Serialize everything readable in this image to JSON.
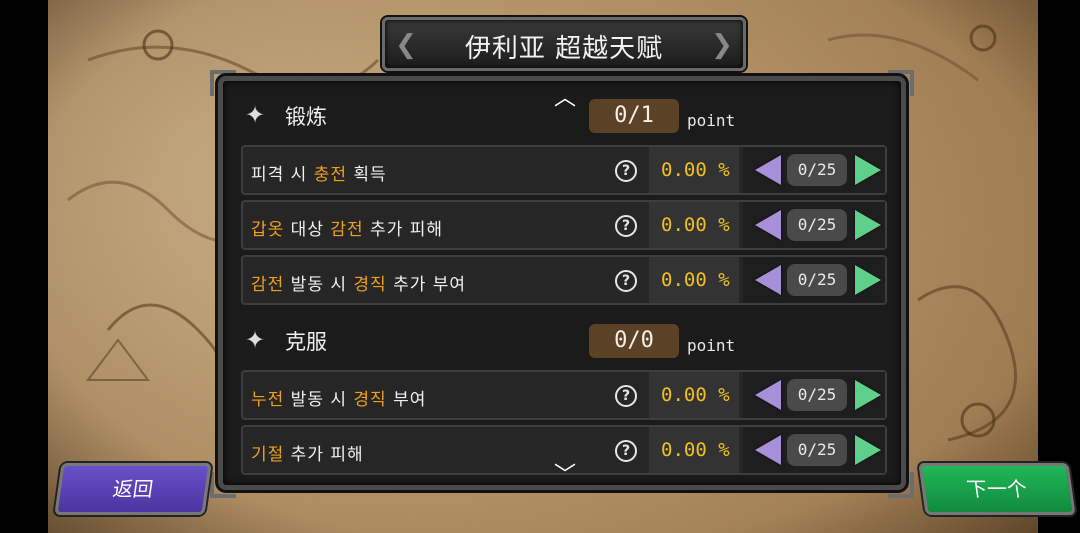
{
  "title": "伊利亚 超越天赋",
  "sections": [
    {
      "name": "锻炼",
      "points": "0/1",
      "point_unit": "point",
      "rows": [
        {
          "segments": [
            {
              "t": "피격 시 ",
              "h": false
            },
            {
              "t": "충전",
              "h": true
            },
            {
              "t": " 획득",
              "h": false
            }
          ],
          "percent": "0.00 %",
          "count": "0/25"
        },
        {
          "segments": [
            {
              "t": "갑옷",
              "h": true
            },
            {
              "t": " 대상 ",
              "h": false
            },
            {
              "t": "감전",
              "h": true
            },
            {
              "t": " 추가 피해",
              "h": false
            }
          ],
          "percent": "0.00 %",
          "count": "0/25"
        },
        {
          "segments": [
            {
              "t": "감전",
              "h": true
            },
            {
              "t": " 발동 시 ",
              "h": false
            },
            {
              "t": "경직",
              "h": true
            },
            {
              "t": " 추가 부여",
              "h": false
            }
          ],
          "percent": "0.00 %",
          "count": "0/25"
        }
      ]
    },
    {
      "name": "克服",
      "points": "0/0",
      "point_unit": "point",
      "rows": [
        {
          "segments": [
            {
              "t": "누전",
              "h": true
            },
            {
              "t": " 발동 시 ",
              "h": false
            },
            {
              "t": "경직",
              "h": true
            },
            {
              "t": " 부여",
              "h": false
            }
          ],
          "percent": "0.00 %",
          "count": "0/25"
        },
        {
          "segments": [
            {
              "t": "기절",
              "h": true
            },
            {
              "t": " 추가 피해",
              "h": false
            }
          ],
          "percent": "0.00 %",
          "count": "0/25"
        }
      ]
    }
  ],
  "buttons": {
    "back": "返回",
    "next": "下一个"
  },
  "icons": {
    "section": "diamond-icon",
    "help": "question-circle-icon",
    "decrease": "left-arrow-icon",
    "increase": "right-arrow-icon",
    "scroll_up": "chevron-up-icon",
    "scroll_down": "chevron-down-icon"
  },
  "colors": {
    "highlight": "#f0a020",
    "percent": "#f0c020",
    "decrease_arrow": "#a890d8",
    "increase_arrow": "#5fd08a",
    "back_button": "#5a40b8",
    "next_button": "#1aa04c",
    "point_box": "#5b4226"
  }
}
